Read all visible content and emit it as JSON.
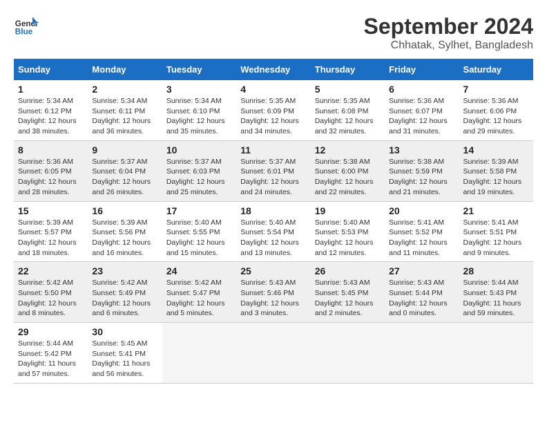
{
  "header": {
    "logo_line1": "General",
    "logo_line2": "Blue",
    "title": "September 2024",
    "subtitle": "Chhatak, Sylhet, Bangladesh"
  },
  "columns": [
    "Sunday",
    "Monday",
    "Tuesday",
    "Wednesday",
    "Thursday",
    "Friday",
    "Saturday"
  ],
  "weeks": [
    {
      "days": [
        {
          "num": "1",
          "sunrise": "5:34 AM",
          "sunset": "6:12 PM",
          "daylight": "12 hours and 38 minutes."
        },
        {
          "num": "2",
          "sunrise": "5:34 AM",
          "sunset": "6:11 PM",
          "daylight": "12 hours and 36 minutes."
        },
        {
          "num": "3",
          "sunrise": "5:34 AM",
          "sunset": "6:10 PM",
          "daylight": "12 hours and 35 minutes."
        },
        {
          "num": "4",
          "sunrise": "5:35 AM",
          "sunset": "6:09 PM",
          "daylight": "12 hours and 34 minutes."
        },
        {
          "num": "5",
          "sunrise": "5:35 AM",
          "sunset": "6:08 PM",
          "daylight": "12 hours and 32 minutes."
        },
        {
          "num": "6",
          "sunrise": "5:36 AM",
          "sunset": "6:07 PM",
          "daylight": "12 hours and 31 minutes."
        },
        {
          "num": "7",
          "sunrise": "5:36 AM",
          "sunset": "6:06 PM",
          "daylight": "12 hours and 29 minutes."
        }
      ]
    },
    {
      "days": [
        {
          "num": "8",
          "sunrise": "5:36 AM",
          "sunset": "6:05 PM",
          "daylight": "12 hours and 28 minutes."
        },
        {
          "num": "9",
          "sunrise": "5:37 AM",
          "sunset": "6:04 PM",
          "daylight": "12 hours and 26 minutes."
        },
        {
          "num": "10",
          "sunrise": "5:37 AM",
          "sunset": "6:03 PM",
          "daylight": "12 hours and 25 minutes."
        },
        {
          "num": "11",
          "sunrise": "5:37 AM",
          "sunset": "6:01 PM",
          "daylight": "12 hours and 24 minutes."
        },
        {
          "num": "12",
          "sunrise": "5:38 AM",
          "sunset": "6:00 PM",
          "daylight": "12 hours and 22 minutes."
        },
        {
          "num": "13",
          "sunrise": "5:38 AM",
          "sunset": "5:59 PM",
          "daylight": "12 hours and 21 minutes."
        },
        {
          "num": "14",
          "sunrise": "5:39 AM",
          "sunset": "5:58 PM",
          "daylight": "12 hours and 19 minutes."
        }
      ]
    },
    {
      "days": [
        {
          "num": "15",
          "sunrise": "5:39 AM",
          "sunset": "5:57 PM",
          "daylight": "12 hours and 18 minutes."
        },
        {
          "num": "16",
          "sunrise": "5:39 AM",
          "sunset": "5:56 PM",
          "daylight": "12 hours and 16 minutes."
        },
        {
          "num": "17",
          "sunrise": "5:40 AM",
          "sunset": "5:55 PM",
          "daylight": "12 hours and 15 minutes."
        },
        {
          "num": "18",
          "sunrise": "5:40 AM",
          "sunset": "5:54 PM",
          "daylight": "12 hours and 13 minutes."
        },
        {
          "num": "19",
          "sunrise": "5:40 AM",
          "sunset": "5:53 PM",
          "daylight": "12 hours and 12 minutes."
        },
        {
          "num": "20",
          "sunrise": "5:41 AM",
          "sunset": "5:52 PM",
          "daylight": "12 hours and 11 minutes."
        },
        {
          "num": "21",
          "sunrise": "5:41 AM",
          "sunset": "5:51 PM",
          "daylight": "12 hours and 9 minutes."
        }
      ]
    },
    {
      "days": [
        {
          "num": "22",
          "sunrise": "5:42 AM",
          "sunset": "5:50 PM",
          "daylight": "12 hours and 8 minutes."
        },
        {
          "num": "23",
          "sunrise": "5:42 AM",
          "sunset": "5:49 PM",
          "daylight": "12 hours and 6 minutes."
        },
        {
          "num": "24",
          "sunrise": "5:42 AM",
          "sunset": "5:47 PM",
          "daylight": "12 hours and 5 minutes."
        },
        {
          "num": "25",
          "sunrise": "5:43 AM",
          "sunset": "5:46 PM",
          "daylight": "12 hours and 3 minutes."
        },
        {
          "num": "26",
          "sunrise": "5:43 AM",
          "sunset": "5:45 PM",
          "daylight": "12 hours and 2 minutes."
        },
        {
          "num": "27",
          "sunrise": "5:43 AM",
          "sunset": "5:44 PM",
          "daylight": "12 hours and 0 minutes."
        },
        {
          "num": "28",
          "sunrise": "5:44 AM",
          "sunset": "5:43 PM",
          "daylight": "11 hours and 59 minutes."
        }
      ]
    },
    {
      "days": [
        {
          "num": "29",
          "sunrise": "5:44 AM",
          "sunset": "5:42 PM",
          "daylight": "11 hours and 57 minutes."
        },
        {
          "num": "30",
          "sunrise": "5:45 AM",
          "sunset": "5:41 PM",
          "daylight": "11 hours and 56 minutes."
        },
        null,
        null,
        null,
        null,
        null
      ]
    }
  ],
  "labels": {
    "sunrise": "Sunrise:",
    "sunset": "Sunset:",
    "daylight": "Daylight:"
  }
}
